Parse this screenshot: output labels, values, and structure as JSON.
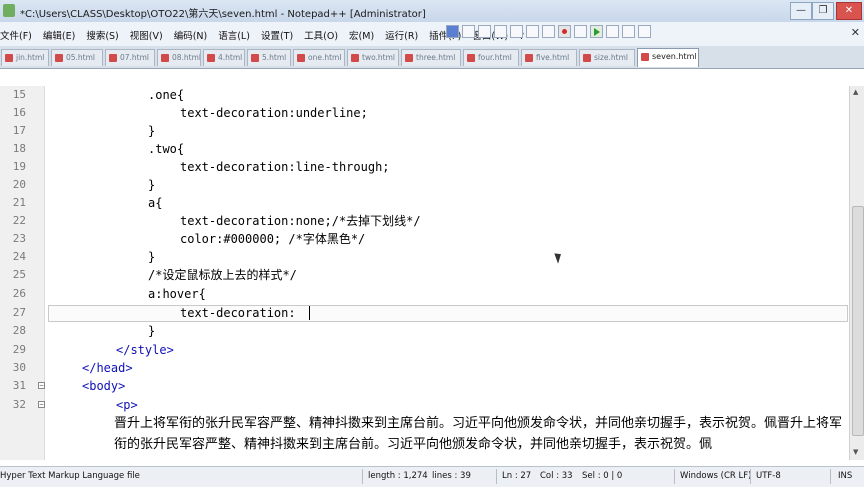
{
  "window": {
    "title": "*C:\\Users\\CLASS\\Desktop\\OTO22\\第六天\\seven.html - Notepad++ [Administrator]",
    "buttons": [
      "—",
      "❐",
      "✕"
    ]
  },
  "menu": [
    "文件(F)",
    "编辑(E)",
    "搜索(S)",
    "视图(V)",
    "编码(N)",
    "语言(L)",
    "设置(T)",
    "工具(O)",
    "宏(M)",
    "运行(R)",
    "插件(P)",
    "窗口(W)",
    "?"
  ],
  "tabs": [
    "jin.html",
    "05.html",
    "07.html",
    "08.html",
    "4.html",
    "5.html",
    "one.html",
    "two.html",
    "three.html",
    "four.html",
    "five.html",
    "size.html",
    "seven.html"
  ],
  "editor": {
    "lines": [
      {
        "n": "15",
        "text": ".one{"
      },
      {
        "n": "16",
        "text": "text-decoration:underline;"
      },
      {
        "n": "17",
        "text": "}"
      },
      {
        "n": "18",
        "text": ".two{"
      },
      {
        "n": "19",
        "text": "text-decoration:line-through;"
      },
      {
        "n": "20",
        "text": "}"
      },
      {
        "n": "21",
        "text": "a{"
      },
      {
        "n": "22",
        "text": "text-decoration:none;/*去掉下划线*/"
      },
      {
        "n": "23",
        "text": "color:#000000; /*字体黑色*/"
      },
      {
        "n": "24",
        "text": "}"
      },
      {
        "n": "25",
        "text": "/*设定鼠标放上去的样式*/"
      },
      {
        "n": "26",
        "text": "a:hover{"
      },
      {
        "n": "27",
        "text": "text-decoration:"
      },
      {
        "n": "28",
        "text": "}"
      },
      {
        "n": "29",
        "text": "</style>"
      },
      {
        "n": "30",
        "text": "</head>"
      },
      {
        "n": "31",
        "text": "<body>"
      },
      {
        "n": "32",
        "text": "<p>"
      }
    ],
    "paragraph": "晋升上将军衔的张升民军容严整、精神抖擞来到主席台前。习近平向他颁发命令状，并同他亲切握手，表示祝贺。佩晋升上将军衔的张升民军容严整、精神抖擞来到主席台前。习近平向他颁发命令状，并同他亲切握手，表示祝贺。佩"
  },
  "status": {
    "file_type": "Hyper Text Markup Language file",
    "length": "length : 1,274",
    "lines": "lines : 39",
    "ln": "Ln : 27",
    "col": "Col : 33",
    "sel": "Sel : 0 | 0",
    "eol": "Windows (CR LF)",
    "encoding": "UTF-8",
    "mode": "INS"
  },
  "colors": {
    "tag_blue": "#1010b8",
    "text_black": "#000000",
    "gutter_bg": "#f0f0f0"
  }
}
